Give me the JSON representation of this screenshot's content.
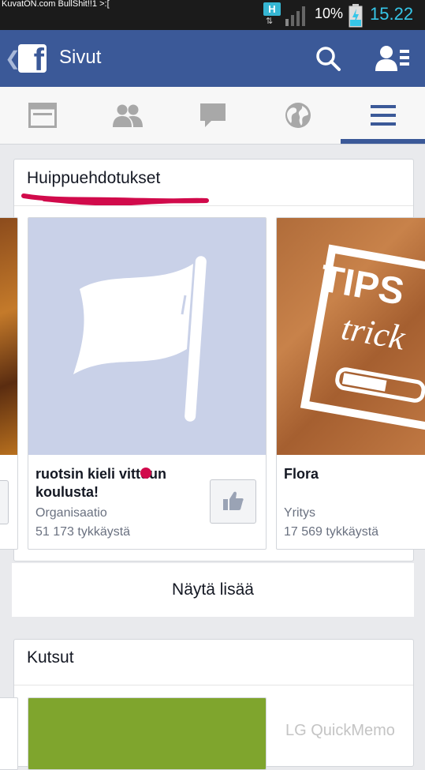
{
  "status_bar": {
    "watermark": "KuvatON.com BullShit!!1 >:[",
    "network_badge": "H",
    "battery_percent": "10%",
    "time": "15.22"
  },
  "app_bar": {
    "title": "Sivut",
    "logo_letter": "f",
    "back_glyph": "❮"
  },
  "tabs": [
    {
      "icon": "feed-icon",
      "active": false
    },
    {
      "icon": "friends-icon",
      "active": false
    },
    {
      "icon": "messages-icon",
      "active": false
    },
    {
      "icon": "globe-icon",
      "active": false
    },
    {
      "icon": "menu-icon",
      "active": true
    }
  ],
  "suggestions": {
    "title": "Huippuehdotukset",
    "annotation_color": "#d10a4b",
    "cards": [
      {
        "name": "ruotsin kieli vittuun koulusta!",
        "category": "Organisaatio",
        "likes": "51 173 tykkäystä"
      },
      {
        "name": "Flora",
        "category": "Yritys",
        "likes": "17 569 tykkäystä",
        "image_text": [
          "TIPS",
          "trick"
        ]
      }
    ],
    "see_more": "Näytä lisää"
  },
  "invites": {
    "title": "Kutsut"
  },
  "overlay": {
    "quickmemo": "LG QuickMemo"
  },
  "colors": {
    "facebook_blue": "#3b5998",
    "flag_bg": "#c9d1e8",
    "invite_green": "#7fa52d",
    "time_color": "#36c6e8"
  }
}
